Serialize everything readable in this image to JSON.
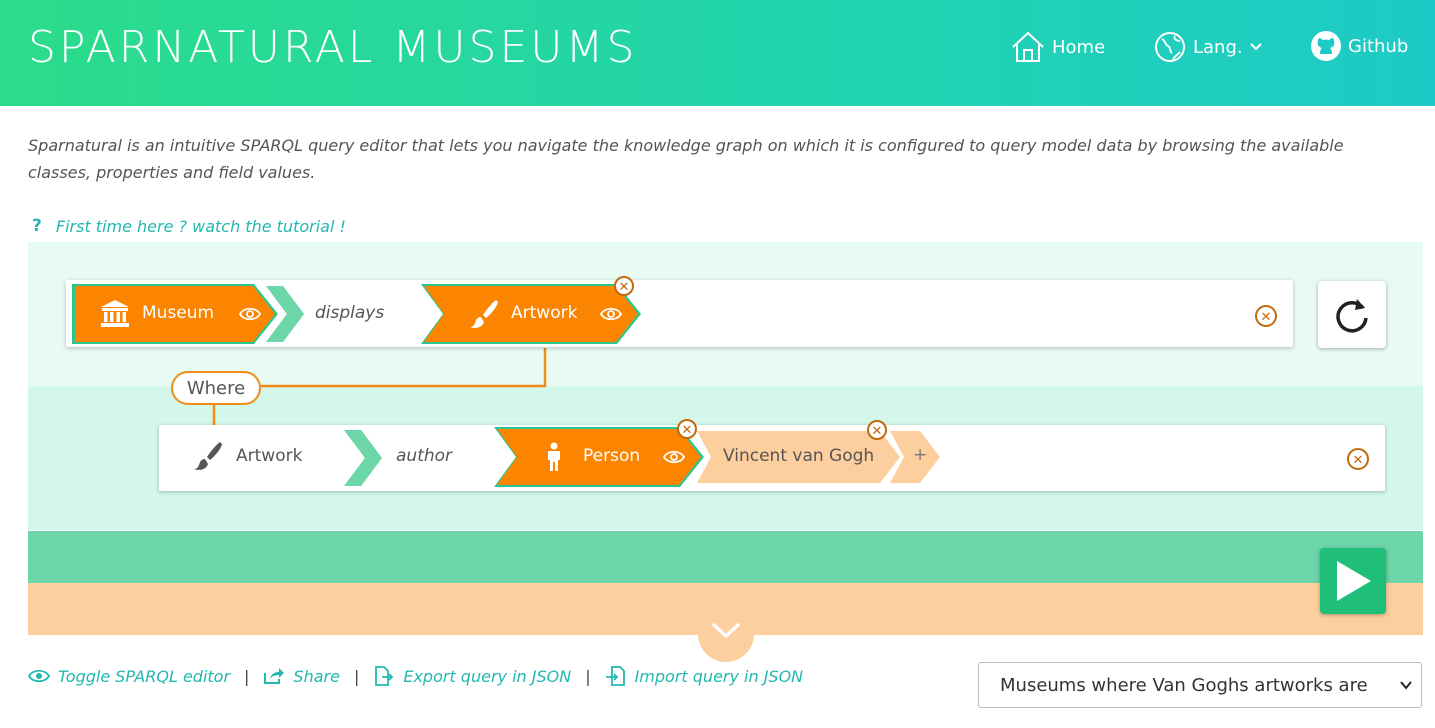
{
  "header": {
    "brand": "SPARNATURAL MUSEUMS",
    "nav": {
      "home": "Home",
      "lang": "Lang.",
      "github": "Github"
    }
  },
  "intro": "Sparnatural is an intuitive SPARQL query editor that lets you navigate the knowledge graph on which it is configured to query model data by browsing the available classes, properties and field values.",
  "tutorial": {
    "mark": "?",
    "text": "First time here ? watch the tutorial !"
  },
  "query": {
    "row1": {
      "subject": "Museum",
      "predicate": "displays",
      "object": "Artwork"
    },
    "where_label": "Where",
    "row2": {
      "subject": "Artwork",
      "predicate": "author",
      "object": "Person",
      "value": "Vincent van Gogh",
      "add": "+"
    }
  },
  "footer_links": {
    "toggle": "Toggle SPARQL editor",
    "share": "Share",
    "export": "Export query in JSON",
    "import": "Import query in JSON",
    "separator": "|"
  },
  "examples_select": {
    "selected": "Museums where Van Goghs artworks are"
  },
  "colors": {
    "orange": "#fb8500",
    "green": "#2cc590",
    "teal": "#22b8b0",
    "peach": "#fdcf9e"
  }
}
